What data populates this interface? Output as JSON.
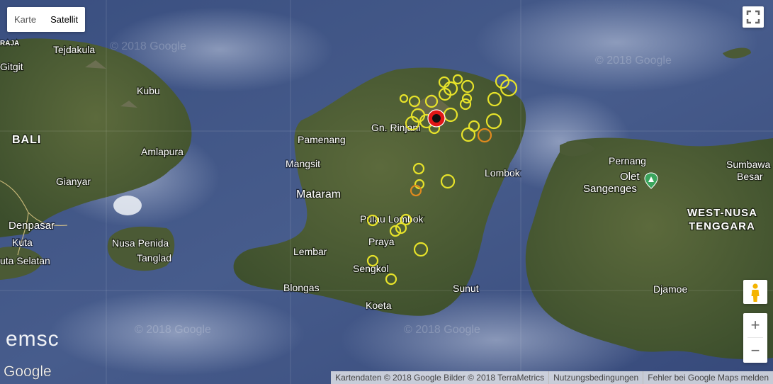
{
  "map_type": {
    "buttons": [
      {
        "label": "Karte",
        "selected": false
      },
      {
        "label": "Satellit",
        "selected": true
      }
    ]
  },
  "watermark": "© 2018 Google",
  "logos": {
    "google": "Google",
    "emsc": "emsc"
  },
  "place_labels": {
    "raja": "RAJA",
    "tejdakula": "Tejdakula",
    "gitgit": "Gitgit",
    "kubu": "Kubu",
    "bali": "BALI",
    "amlapura": "Amlapura",
    "gianyar": "Gianyar",
    "denpasar": "Denpasar",
    "kuta": "Kuta",
    "kuta_selatan": "uta Selatan",
    "nusa_penida": "Nusa Penida",
    "tanglad": "Tanglad",
    "pamenang": "Pamenang",
    "gn_rinjani": "Gn. Rinjani",
    "mangsit": "Mangsit",
    "mataram": "Mataram",
    "lombok": "Lombok",
    "pulau_lombok": "Pulau Lombok",
    "praya": "Praya",
    "lembar": "Lembar",
    "sengkol": "Sengkol",
    "blongas": "Blongas",
    "sunut": "Sunut",
    "koeta": "Koeta",
    "pernang": "Pernang",
    "olet_sangenges_1": "Olet",
    "olet_sangenges_2": "Sangenges",
    "sumbawa_besar_1": "Sumbawa",
    "sumbawa_besar_2": "Besar",
    "west_nusa_1": "WEST-NUSA",
    "west_nusa_2": "TENGGARA",
    "djamoe": "Djamoe"
  },
  "controls": {
    "fullscreen_icon": "fullscreen-icon",
    "pegman_icon": "pegman-icon",
    "zoom_in": "+",
    "zoom_out": "−"
  },
  "footer": {
    "attribution": "Kartendaten © 2018 Google Bilder © 2018 TerraMetrics",
    "terms": "Nutzungsbedingungen",
    "report": "Fehler bei Google Maps melden"
  },
  "colors": {
    "sea": "#3d5283",
    "land": "#4a5b36",
    "marker_yellow": "#e6e22a",
    "marker_orange": "#e08a1e",
    "marker_red": "#e11616"
  }
}
